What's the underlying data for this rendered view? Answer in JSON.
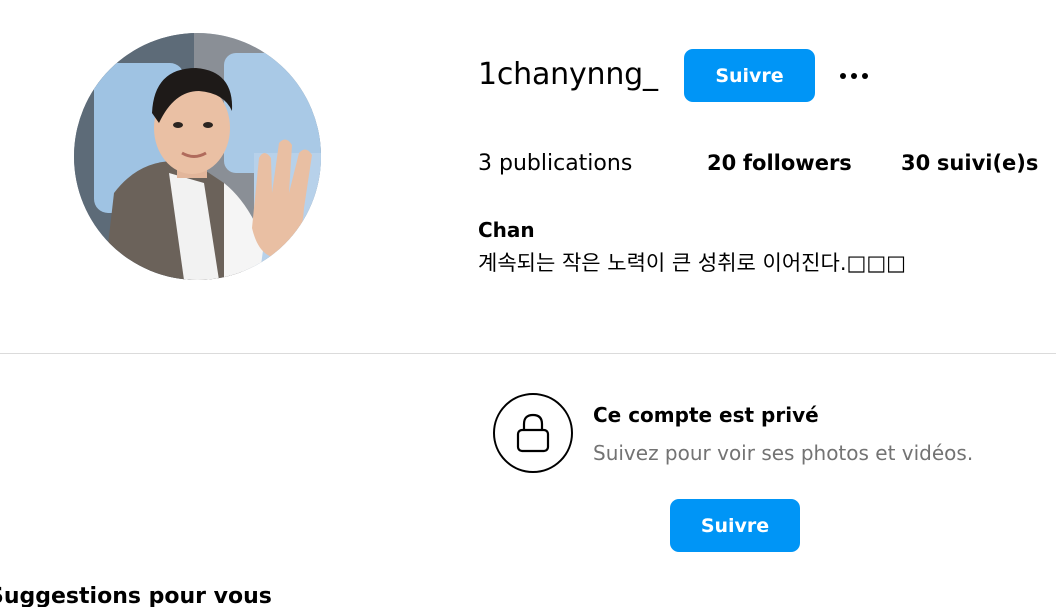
{
  "profile": {
    "username": "1chanynng_",
    "follow_label": "Suivre",
    "more_options_icon": "more-horizontal-icon",
    "avatar_alt": "profile photo"
  },
  "stats": {
    "posts_count": "3",
    "posts_label": "publications",
    "followers_count": "20",
    "followers_label": "followers",
    "following_count": "30",
    "following_label": "suivi(e)s"
  },
  "bio": {
    "name": "Chan",
    "text": "계속되는 작은 노력이 큰 성취로 이어진다.□□□"
  },
  "private_notice": {
    "icon": "lock-icon",
    "title": "Ce compte est privé",
    "subtitle": "Suivez pour voir ses photos et vidéos.",
    "follow_label": "Suivre"
  },
  "suggestions": {
    "heading": "Suggestions pour vous"
  },
  "colors": {
    "accent": "#0095f6",
    "divider": "#dbdbdb",
    "muted_text": "#737373"
  }
}
